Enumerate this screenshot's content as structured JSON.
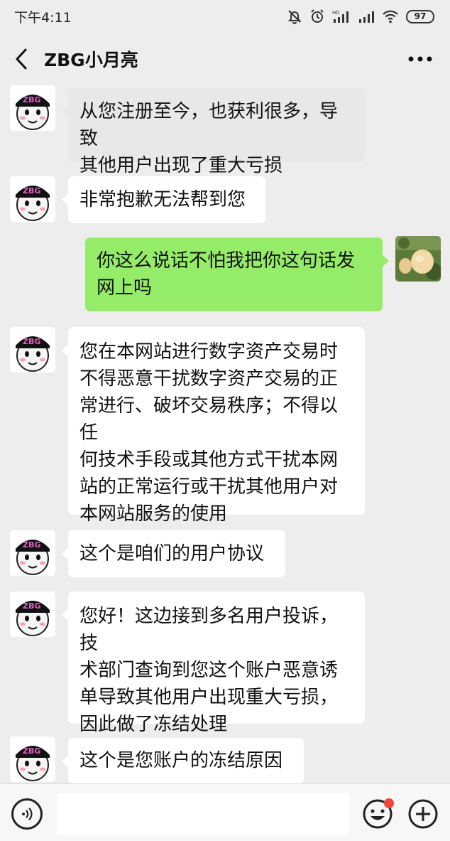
{
  "status_bar": {
    "time": "下午4:11",
    "battery": "97"
  },
  "header": {
    "title": "ZBG小月亮"
  },
  "avatar": {
    "badge_text": "ZBG"
  },
  "messages": [
    {
      "side": "left",
      "text": "从您注册至今，也获利很多，导致\n其他用户出现了重大亏损"
    },
    {
      "side": "left",
      "text": "非常抱歉无法帮到您"
    },
    {
      "side": "right",
      "text": "你这么说话不怕我把你这句话发\n网上吗"
    },
    {
      "side": "left",
      "text": "您在本网站进行数字资产交易时\n不得恶意干扰数字资产交易的正\n常进行、破坏交易秩序；不得以任\n何技术手段或其他方式干扰本网\n站的正常运行或干扰其他用户对\n本网站服务的使用"
    },
    {
      "side": "left",
      "text": "这个是咱们的用户协议"
    },
    {
      "side": "left",
      "text": "您好！这边接到多名用户投诉，技\n术部门查询到您这个账户恶意诱\n单导致其他用户出现重大亏损，\n因此做了冻结处理"
    },
    {
      "side": "left",
      "text": "这个是您账户的冻结原因"
    }
  ],
  "input": {
    "placeholder": ""
  },
  "colors": {
    "background": "#ededed",
    "bubble_sent": "#95ec69",
    "bubble_received": "#ffffff",
    "notification_dot": "#f1463b"
  }
}
